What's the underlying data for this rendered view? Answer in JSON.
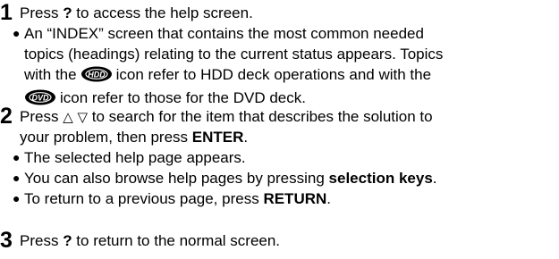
{
  "steps": [
    {
      "num": "1",
      "pre": "Press ",
      "key": "?",
      "post": " to access the help screen.",
      "bullets": {
        "index_l1": "An “INDEX” screen that contains the most common needed",
        "index_l2": "topics (headings) relating to the current status appears. Topics",
        "index_l3a": "with the",
        "index_l3b": "icon refer to HDD deck operations and with the",
        "index_l4": "icon refer to those for the DVD deck."
      },
      "icons": {
        "hdd": "hdd-icon",
        "dvd": "dvd-icon"
      }
    },
    {
      "num": "2",
      "pre": "Press",
      "up": "△",
      "down": "▽",
      "mid": "to search for the item that describes the solution to",
      "line2a": "your problem, then press ",
      "enter": "ENTER",
      "line2b": ".",
      "bullets": {
        "b1": "The selected help page appears.",
        "b2a": "You can also browse help pages by pressing ",
        "b2key": "selection keys",
        "b2b": ".",
        "b3a": "To return to a previous page, press ",
        "b3key": "RETURN",
        "b3b": "."
      }
    },
    {
      "num": "3",
      "pre": "Press ",
      "key": "?",
      "post": " to return to the normal screen."
    }
  ],
  "bullet_char": "●"
}
